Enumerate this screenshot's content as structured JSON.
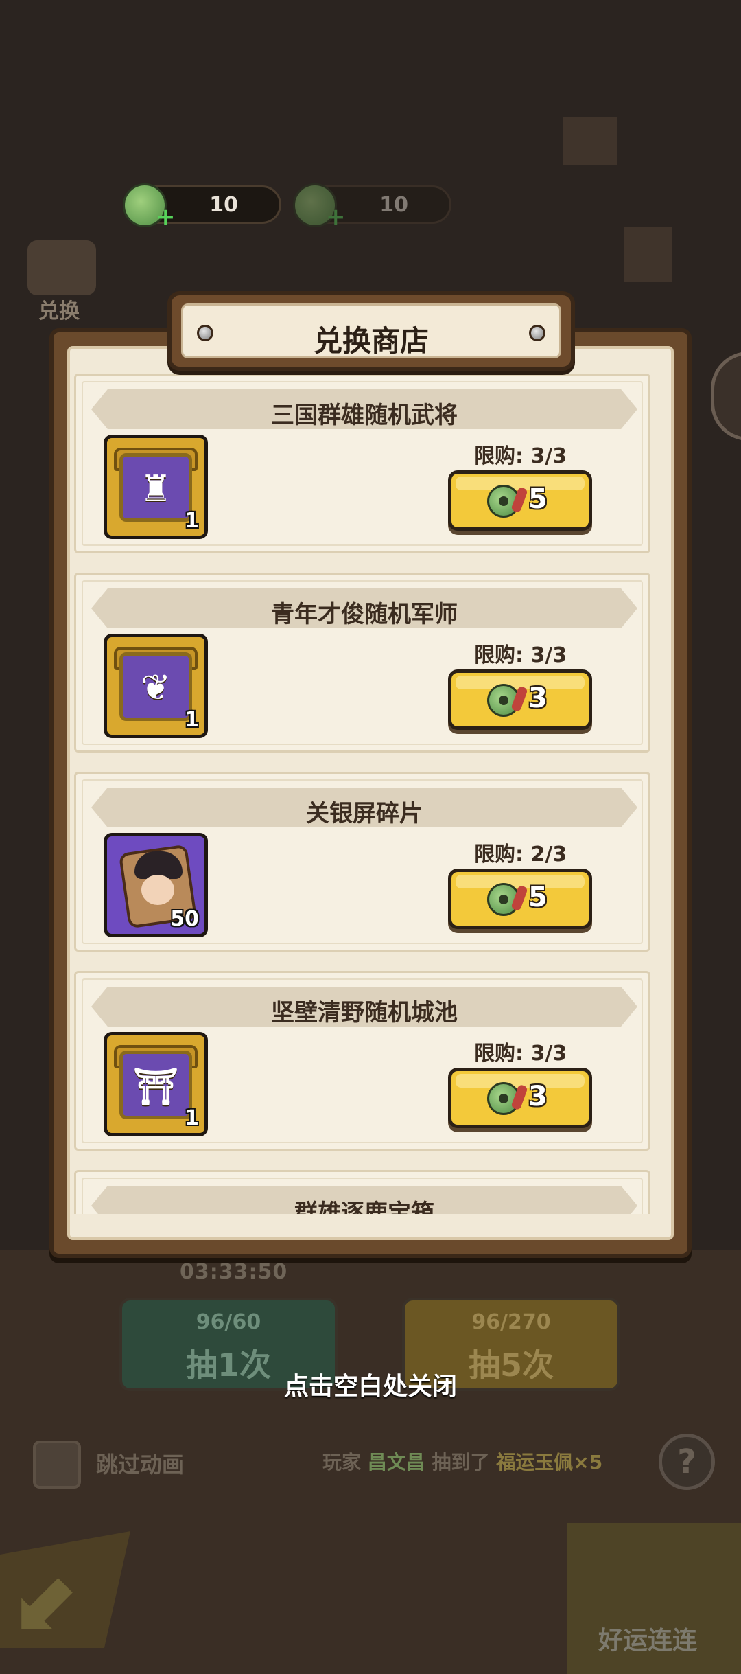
{
  "background": {
    "currency_primary": "10",
    "currency_secondary": "10",
    "exchange_label": "兑换",
    "timer": "03:33:50",
    "draw_one": {
      "cost": "96/60",
      "label": "抽1次"
    },
    "draw_five": {
      "cost": "96/270",
      "label": "抽5次"
    },
    "skip_label": "跳过动画",
    "ticker": {
      "prefix": "玩家",
      "player": "昌文昌",
      "verb": "抽到了",
      "reward": "福运玉佩×5"
    },
    "help_icon": "?",
    "lucky_label": "好运连连"
  },
  "shop": {
    "title": "兑换商店",
    "items": [
      {
        "name": "三国群雄随机武将",
        "limit": "限购: 3/3",
        "price": "5",
        "count": "1",
        "icon": "general-chest-icon",
        "glyph": "♜"
      },
      {
        "name": "青年才俊随机军师",
        "limit": "限购: 3/3",
        "price": "3",
        "count": "1",
        "icon": "strategist-chest-icon",
        "glyph": "❦"
      },
      {
        "name": "关银屏碎片",
        "limit": "限购: 2/3",
        "price": "5",
        "count": "50",
        "icon": "hero-shard-icon"
      },
      {
        "name": "坚壁清野随机城池",
        "limit": "限购: 3/3",
        "price": "3",
        "count": "1",
        "icon": "city-chest-icon",
        "glyph": "⛩"
      }
    ],
    "peek_item_name": "群雄逐鹿宝箱"
  },
  "close_hint": "点击空白处关闭",
  "colors": {
    "button_yellow": "#f3c93a",
    "panel_brown": "#6a4a2c",
    "panel_cream": "#f1e9d7"
  }
}
